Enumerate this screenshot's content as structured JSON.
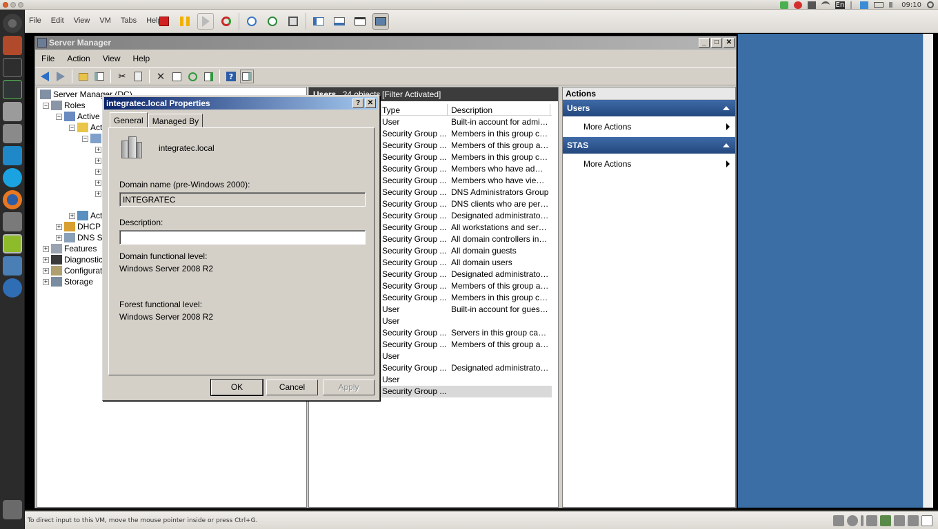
{
  "host": {
    "clock": "09:10",
    "keyboard": "En",
    "vm_menu": [
      "File",
      "Edit",
      "View",
      "VM",
      "Tabs",
      "Help"
    ],
    "status_hint": "To direct input to this VM, move the mouse pointer inside or press Ctrl+G."
  },
  "server_manager": {
    "title": "Server Manager",
    "menu": [
      "File",
      "Action",
      "View",
      "Help"
    ],
    "tree": {
      "root": "Server Manager (DC)",
      "roles": "Roles",
      "active": "Active",
      "act1": "Act",
      "act2": "Act",
      "dhcp": "DHCP S",
      "dns": "DNS Se",
      "features": "Features",
      "diagnostics": "Diagnostics",
      "configuration": "Configurati",
      "storage": "Storage"
    },
    "list": {
      "header_title": "Users",
      "header_count": "24 objects",
      "header_filter": "[Filter Activated]",
      "col_type": "Type",
      "col_description": "Description",
      "rows": [
        {
          "type": "User",
          "description": "Built-in account for admini..."
        },
        {
          "type": "Security Group ...",
          "description": "Members in this group can..."
        },
        {
          "type": "Security Group ...",
          "description": "Members of this group are..."
        },
        {
          "type": "Security Group ...",
          "description": "Members in this group can..."
        },
        {
          "type": "Security Group ...",
          "description": "Members who have admini..."
        },
        {
          "type": "Security Group ...",
          "description": "Members who have view-..."
        },
        {
          "type": "Security Group ...",
          "description": "DNS Administrators Group"
        },
        {
          "type": "Security Group ...",
          "description": "DNS clients who are permi..."
        },
        {
          "type": "Security Group ...",
          "description": "Designated administrators..."
        },
        {
          "type": "Security Group ...",
          "description": "All workstations and serve..."
        },
        {
          "type": "Security Group ...",
          "description": "All domain controllers in th..."
        },
        {
          "type": "Security Group ...",
          "description": "All domain guests"
        },
        {
          "type": "Security Group ...",
          "description": "All domain users"
        },
        {
          "type": "Security Group ...",
          "description": "Designated administrators..."
        },
        {
          "type": "Security Group ...",
          "description": "Members of this group are..."
        },
        {
          "type": "Security Group ...",
          "description": "Members in this group can..."
        },
        {
          "type": "User",
          "description": "Built-in account for guest ..."
        },
        {
          "type": "User",
          "description": ""
        },
        {
          "type": "Security Group ...",
          "description": "Servers in this group can ..."
        },
        {
          "type": "Security Group ...",
          "description": "Members of this group are..."
        },
        {
          "type": "User",
          "description": ""
        },
        {
          "type": "Security Group ...",
          "description": "Designated administrators..."
        },
        {
          "type": "User",
          "description": ""
        },
        {
          "type": "Security Group ...",
          "description": ""
        }
      ]
    },
    "actions": {
      "title": "Actions",
      "sections": [
        {
          "name": "Users",
          "item": "More Actions"
        },
        {
          "name": "STAS",
          "item": "More Actions"
        }
      ]
    }
  },
  "dialog": {
    "title": "integratec.local Properties",
    "help_button": "?",
    "close_button": "✕",
    "tabs": [
      "General",
      "Managed By"
    ],
    "domain_name": "integratec.local",
    "prewin_label": "Domain name (pre-Windows 2000):",
    "prewin_value": "INTEGRATEC",
    "description_label": "Description:",
    "description_value": "",
    "dfl_label": "Domain functional level:",
    "dfl_value": "Windows Server 2008 R2",
    "ffl_label": "Forest functional level:",
    "ffl_value": "Windows Server 2008 R2",
    "ok": "OK",
    "cancel": "Cancel",
    "apply": "Apply"
  }
}
